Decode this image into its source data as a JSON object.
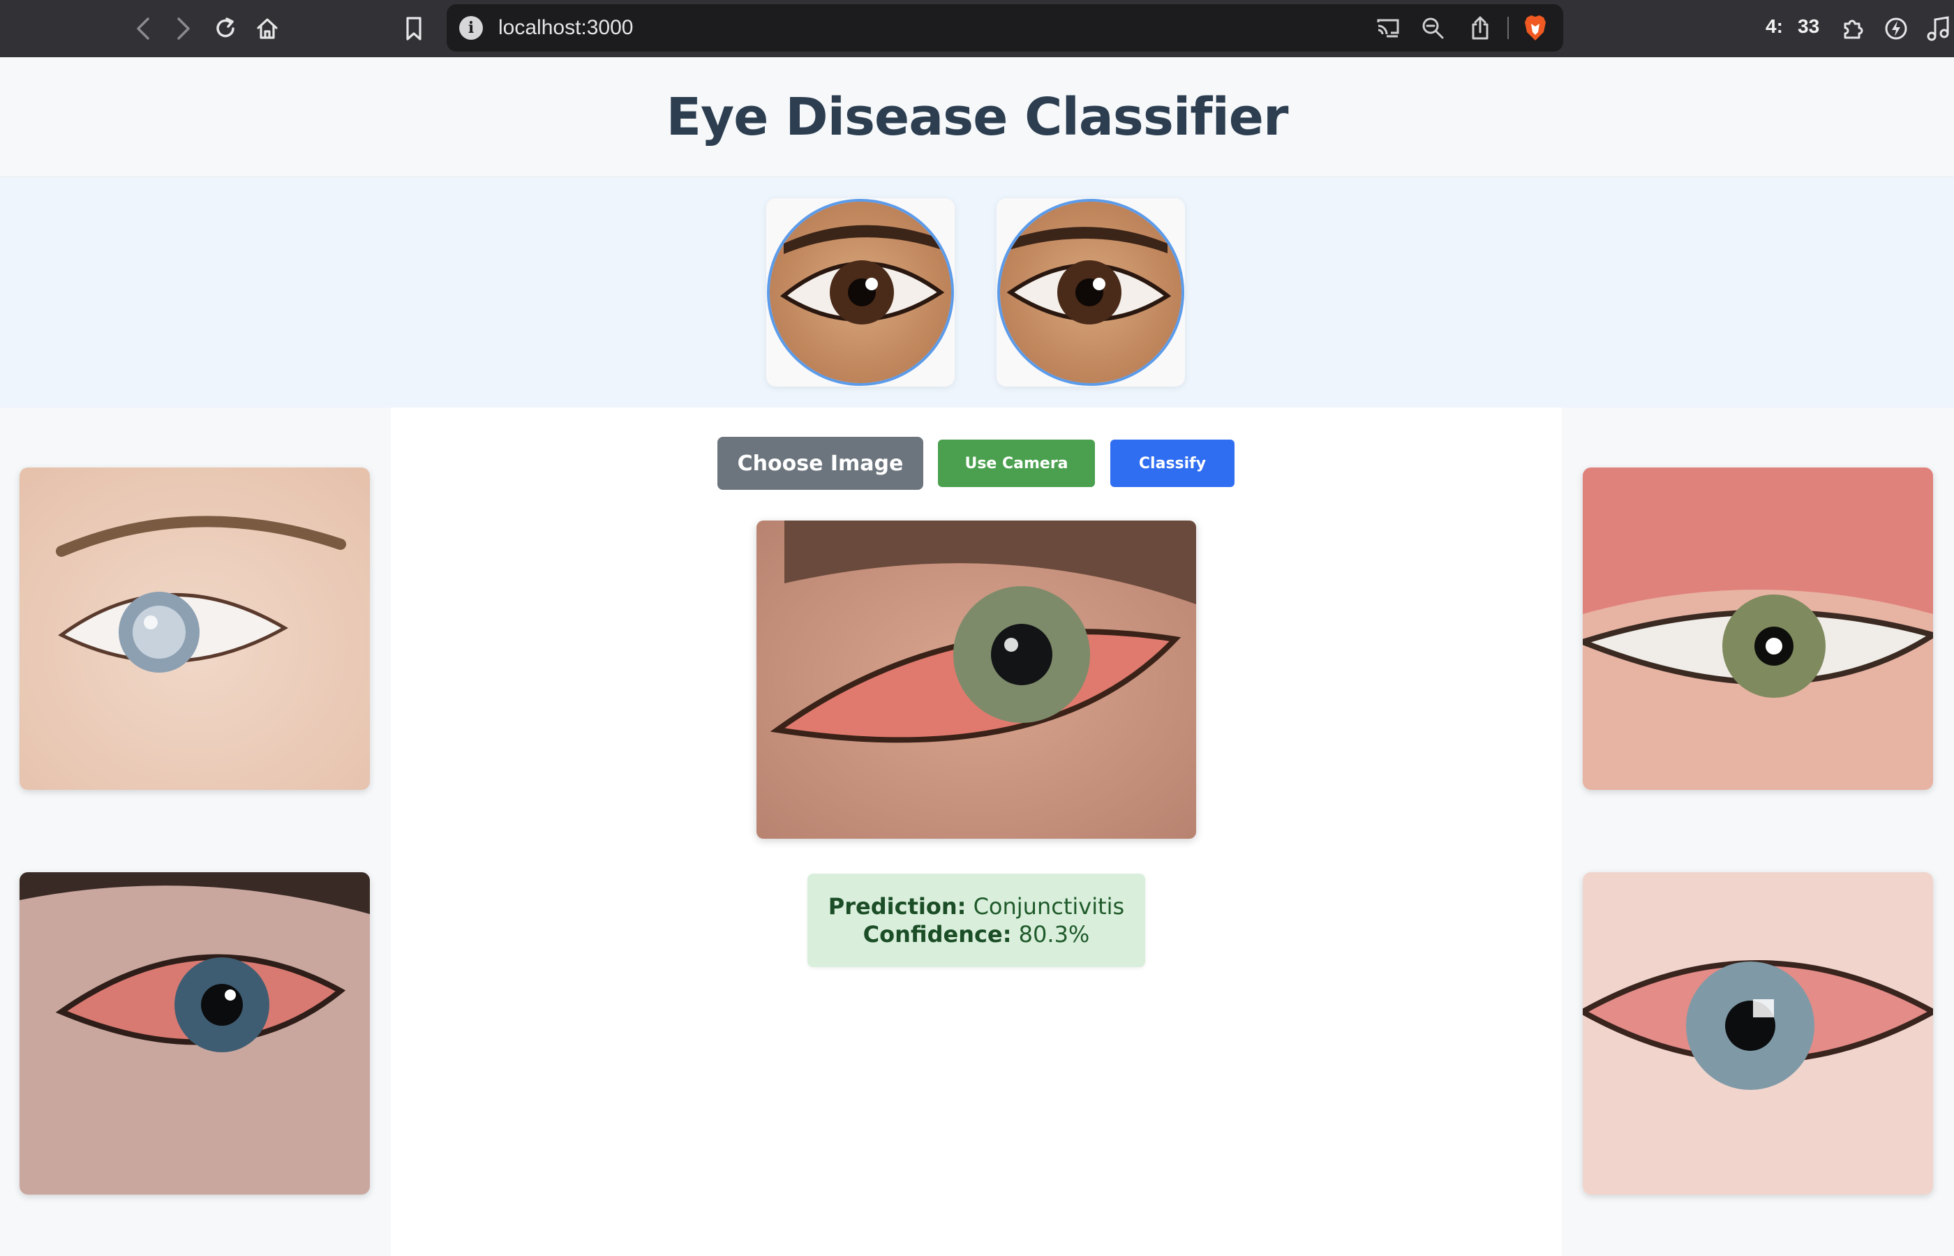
{
  "browser": {
    "url": "localhost:3000",
    "clock_hours": "4:",
    "clock_minutes": "33",
    "icons": [
      "back-icon",
      "forward-icon",
      "reload-icon",
      "home-icon",
      "bookmark-icon",
      "info-icon",
      "cast-icon",
      "zoom-out-icon",
      "share-icon",
      "brave-shield-icon",
      "extensions-icon",
      "leo-icon",
      "music-icon"
    ]
  },
  "page": {
    "title": "Eye Disease Classifier"
  },
  "actions": {
    "choose_image": "Choose Image",
    "use_camera": "Use Camera",
    "classify": "Classify"
  },
  "result": {
    "prediction_label": "Prediction:",
    "prediction_value": " Conjunctivitis",
    "confidence_label": "Confidence:",
    "confidence_value": " 80.3%"
  },
  "colors": {
    "title": "#2c3e50",
    "choose_button": "#6c757d",
    "camera_button": "#4aa04e",
    "classify_button": "#2f6df1",
    "result_bg": "#d9efdc",
    "hero_bg": "#eef5fd"
  }
}
